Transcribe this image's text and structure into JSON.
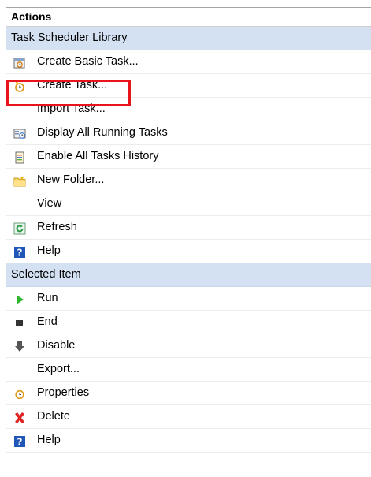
{
  "panel": {
    "title": "Actions"
  },
  "sections": [
    {
      "header": "Task Scheduler Library",
      "items": [
        {
          "label": "Create Basic Task...",
          "icon": "create-basic-task-icon"
        },
        {
          "label": "Create Task...",
          "icon": "create-task-icon"
        },
        {
          "label": "Import Task...",
          "icon": ""
        },
        {
          "label": "Display All Running Tasks",
          "icon": "running-tasks-icon"
        },
        {
          "label": "Enable All Tasks History",
          "icon": "tasks-history-icon"
        },
        {
          "label": "New Folder...",
          "icon": "folder-icon"
        },
        {
          "label": "View",
          "icon": ""
        },
        {
          "label": "Refresh",
          "icon": "refresh-icon"
        },
        {
          "label": "Help",
          "icon": "help-icon"
        }
      ]
    },
    {
      "header": "Selected Item",
      "items": [
        {
          "label": "Run",
          "icon": "run-icon"
        },
        {
          "label": "End",
          "icon": "end-icon"
        },
        {
          "label": "Disable",
          "icon": "disable-icon"
        },
        {
          "label": "Export...",
          "icon": ""
        },
        {
          "label": "Properties",
          "icon": "properties-icon"
        },
        {
          "label": "Delete",
          "icon": "delete-icon"
        },
        {
          "label": "Help",
          "icon": "help-icon"
        }
      ]
    }
  ],
  "colors": {
    "section_bg": "#d4e1f2",
    "highlight": "#e8131b"
  }
}
